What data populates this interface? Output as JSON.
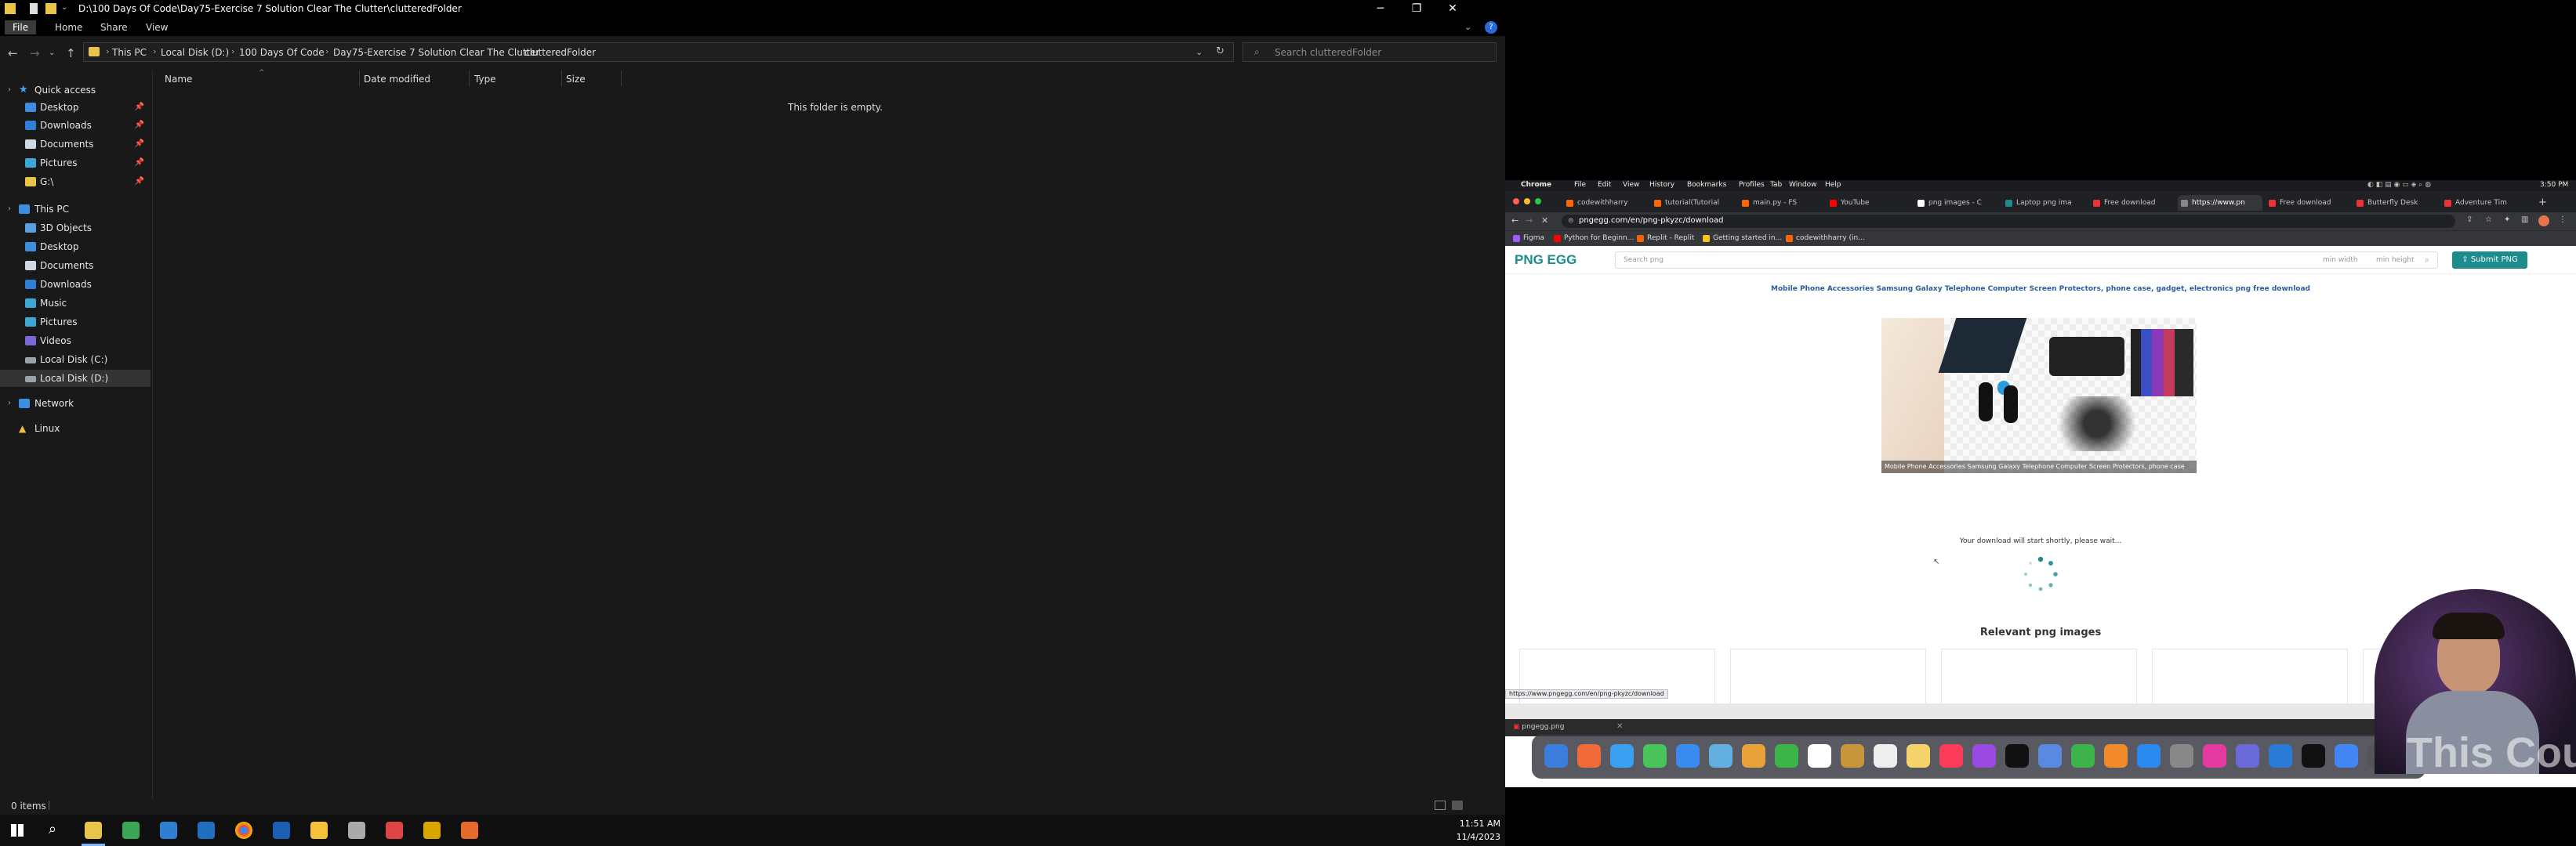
{
  "explorer": {
    "title": "D:\\100 Days Of Code\\Day75-Exercise 7 Solution Clear The Clutter\\clutteredFolder",
    "ribbon_tabs": [
      "File",
      "Home",
      "Share",
      "View"
    ],
    "breadcrumbs": [
      "This PC",
      "Local Disk (D:)",
      "100 Days Of Code",
      "Day75-Exercise 7 Solution Clear The Clutter",
      "clutteredFolder"
    ],
    "search_placeholder": "Search clutteredFolder",
    "nav": {
      "quick_access": "Quick access",
      "quick_items": [
        "Desktop",
        "Downloads",
        "Documents",
        "Pictures",
        "G:\\"
      ],
      "this_pc": "This PC",
      "pc_items": [
        "3D Objects",
        "Desktop",
        "Documents",
        "Downloads",
        "Music",
        "Pictures",
        "Videos",
        "Local Disk (C:)",
        "Local Disk (D:)"
      ],
      "network": "Network",
      "linux": "Linux"
    },
    "columns": [
      "Name",
      "Date modified",
      "Type",
      "Size"
    ],
    "empty_message": "This folder is empty.",
    "status": "0 items"
  },
  "taskbar": {
    "time": "11:51 AM",
    "date": "11/4/2023"
  },
  "mac": {
    "menubar": [
      "Chrome",
      "File",
      "Edit",
      "View",
      "History",
      "Bookmarks",
      "Profiles",
      "Tab",
      "Window",
      "Help"
    ],
    "clock": "3:50 PM",
    "tabs": [
      "codewithharry",
      "tutorial(Tutorial",
      "main.py - FS",
      "YouTube",
      "png images - C",
      "Laptop png ima",
      "Free download",
      "https://www.pn",
      "Free download",
      "Butterfly Desk",
      "Adventure Tim"
    ],
    "url": "pngegg.com/en/png-pkyzc/download",
    "bookmarks": [
      "Figma",
      "Python for Beginn...",
      "Replit - Replit",
      "Getting started in...",
      "codewithharry (in..."
    ],
    "site": {
      "logo": "PNG EGG",
      "search_placeholder": "Search png",
      "min_width": "min width",
      "min_height": "min height",
      "submit": "Submit PNG",
      "png_title": "Mobile Phone Accessories Samsung Galaxy Telephone Computer Screen Protectors, phone case, gadget, electronics png free download",
      "preview_caption": "Mobile Phone Accessories Samsung Galaxy Telephone Computer Screen Protectors, phone case",
      "download_msg": "Your download will start shortly, please wait...",
      "relevant_title": "Relevant png images",
      "status_url": "https://www.pngegg.com/en/png-pkyzc/download",
      "download_file": "pngegg.png"
    }
  },
  "watermark": "This Cou"
}
